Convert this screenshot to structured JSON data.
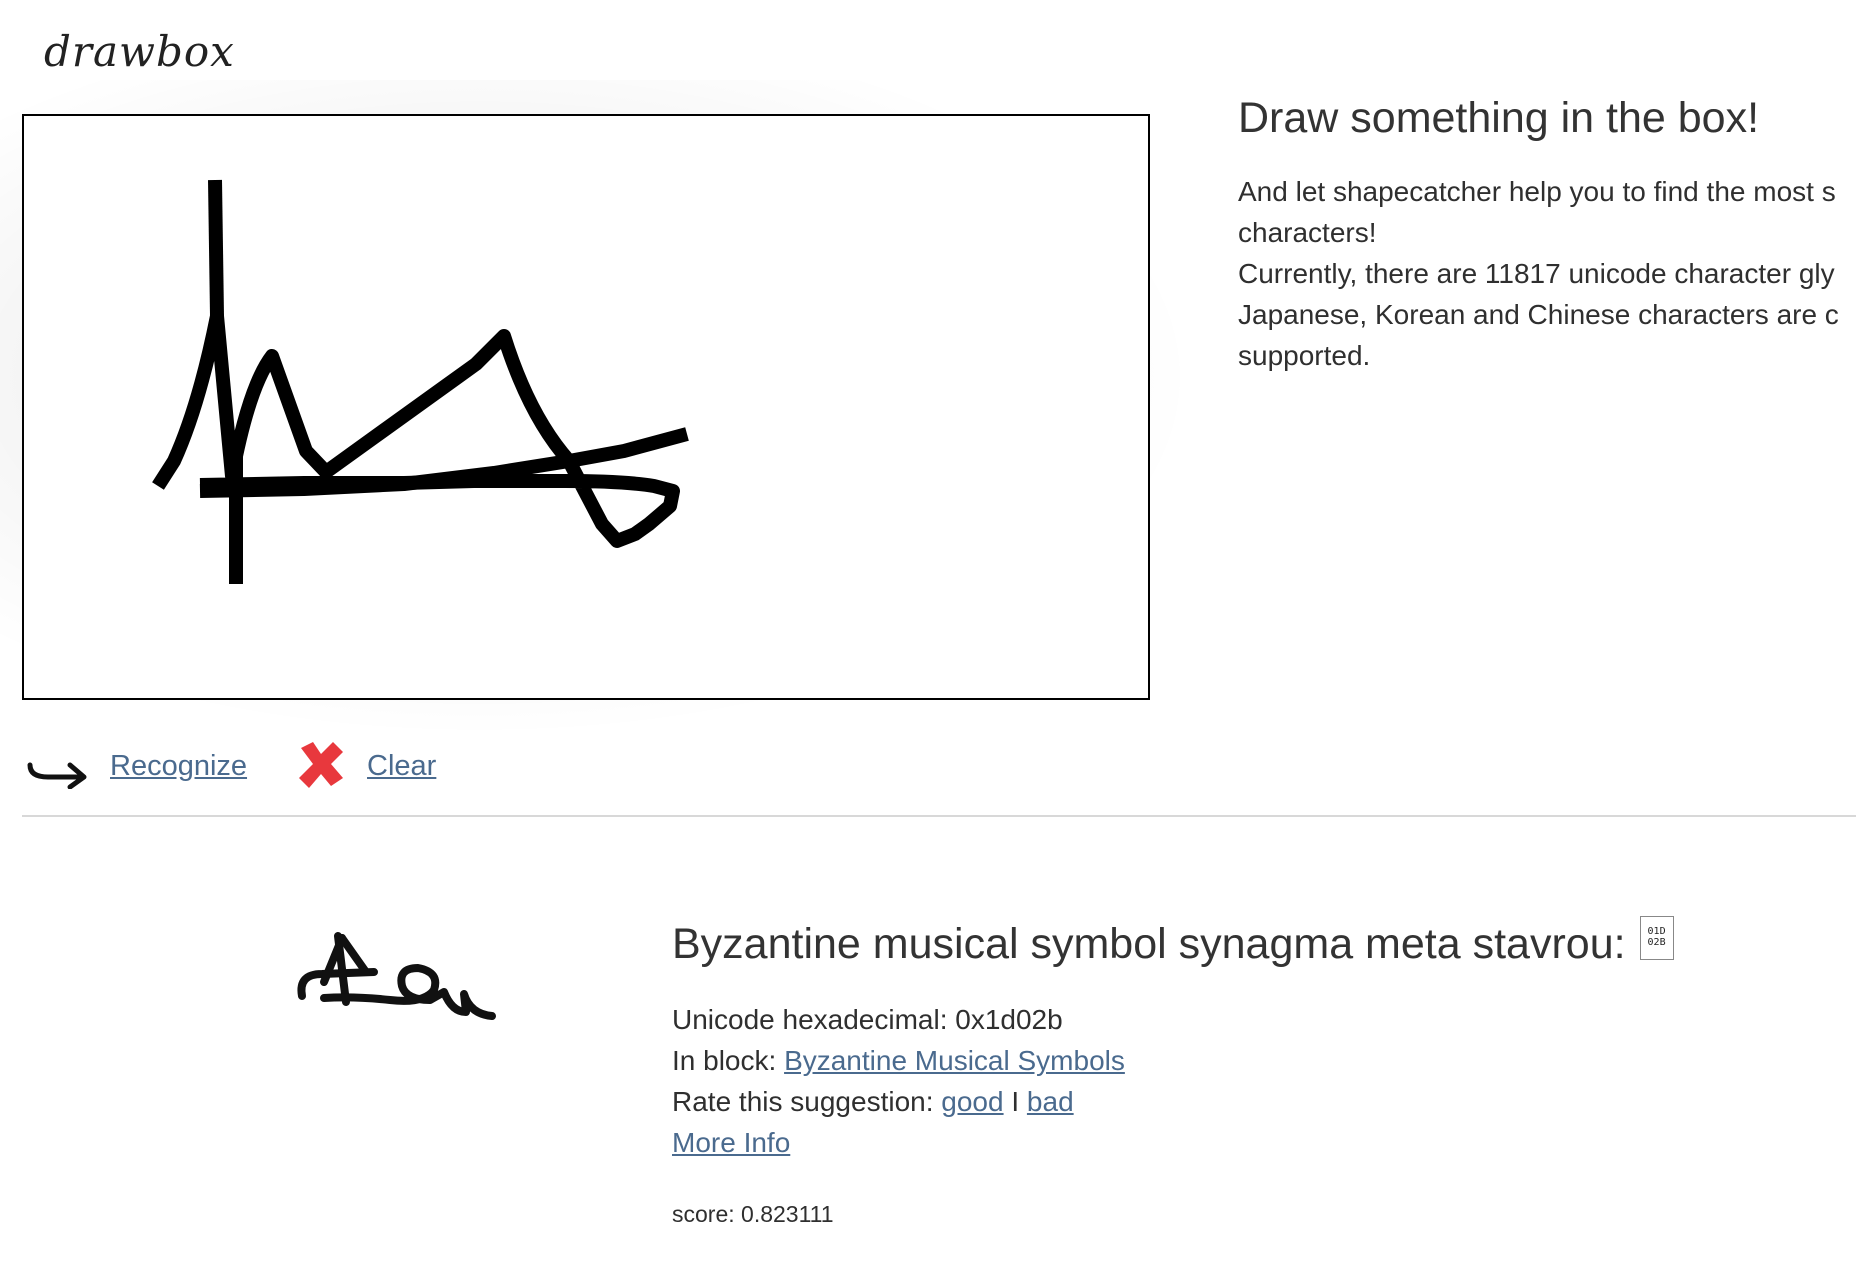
{
  "logo": {
    "text": "drawbox"
  },
  "tools": {
    "recognize_label": "Recognize",
    "clear_label": "Clear",
    "recognize_icon": "curved-arrow-icon",
    "clear_icon": "red-x-icon",
    "clear_icon_color": "#e8383d"
  },
  "intro": {
    "title": "Draw something in the box!",
    "lines": [
      "And let shapecatcher help you to find the most s",
      "characters!",
      "Currently, there are 11817 unicode character gly",
      "Japanese, Korean and Chinese characters are c",
      "supported."
    ]
  },
  "result": {
    "title": "Byzantine musical symbol synagma meta stavrou:",
    "glyph_box_lines": [
      "01D",
      "02B"
    ],
    "hex_label": "Unicode hexadecimal: 0x1d02b",
    "block_prefix": "In block: ",
    "block_link": "Byzantine Musical Symbols",
    "rate_prefix": "Rate this suggestion: ",
    "rate_good": "good",
    "rate_separator": " I ",
    "rate_bad": "bad",
    "more_info": "More Info",
    "score": "score: 0.823111"
  },
  "colors": {
    "link": "#4a6a8e",
    "stroke": "#000000",
    "divider": "#d8d8d8"
  }
}
